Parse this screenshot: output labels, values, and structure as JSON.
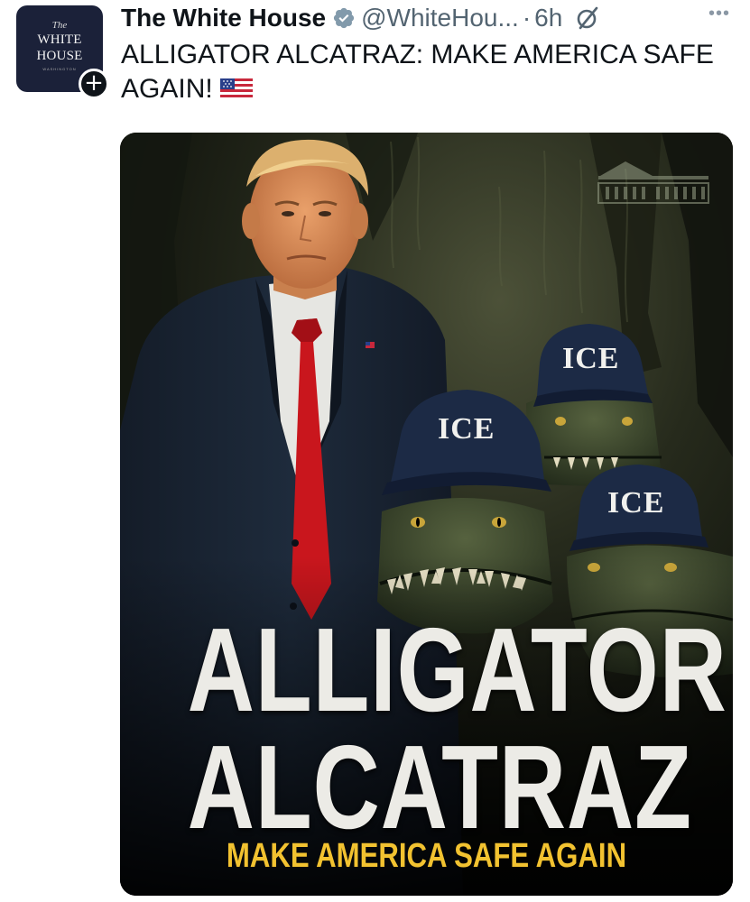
{
  "author": {
    "display_name": "The White House",
    "handle": "@WhiteHou...",
    "separator": "·",
    "time": "6h",
    "verified": true,
    "avatar": {
      "line_the": "The",
      "line_1": "WHITE",
      "line_2": "HOUSE",
      "line_sub": "WASHINGTON"
    }
  },
  "post": {
    "text": "ALLIGATOR ALCATRAZ: MAKE AMERICA SAFE AGAIN!",
    "emoji": "🇺🇸"
  },
  "media": {
    "title_line_1": "ALLIGATOR",
    "title_line_2": "ALCATRAZ",
    "tagline": "MAKE AMERICA SAFE AGAIN",
    "cap_labels": [
      "ICE",
      "ICE",
      "ICE"
    ]
  },
  "icons": {
    "verified": "verified-badge-icon",
    "follow": "plus-icon",
    "grok": "grok-slash-icon",
    "more": "more-dots-icon",
    "flag": "us-flag-icon"
  },
  "colors": {
    "text": "#0f1419",
    "secondary_text": "#536471",
    "verified_badge": "#829aab",
    "avatar_bg": "#1b2139",
    "tagline_yellow": "#f2c230",
    "title_white": "#ecebe6",
    "cap_navy": "#1c2a45",
    "alligator_green": "#3d4a33"
  }
}
